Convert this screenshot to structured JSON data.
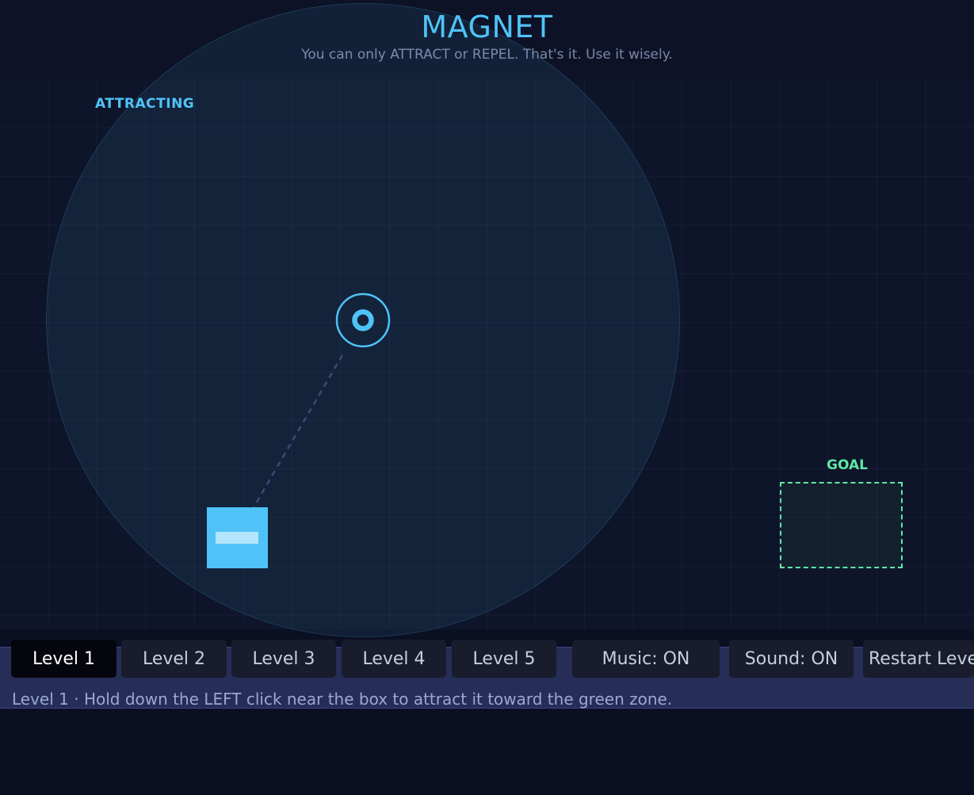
{
  "header": {
    "title": "MAGNET",
    "subtitle": "You can only ATTRACT or REPEL. That's it. Use it wisely."
  },
  "game": {
    "mode_label": "ATTRACTING",
    "goal_label": "GOAL",
    "box_polarity": "minus"
  },
  "controls": {
    "levels": [
      {
        "label": "Level 1",
        "active": true
      },
      {
        "label": "Level 2",
        "active": false
      },
      {
        "label": "Level 3",
        "active": false
      },
      {
        "label": "Level 4",
        "active": false
      },
      {
        "label": "Level 5",
        "active": false
      }
    ],
    "music_label": "Music: ON",
    "sound_label": "Sound: ON",
    "restart_label": "Restart Level"
  },
  "status": {
    "text": "Level 1 · Hold down the LEFT click near the box to attract it toward the green zone."
  },
  "colors": {
    "accent": "#4fc3f7",
    "goal": "#5ee7a8",
    "ground": "#262d57",
    "background": "#0b0f22"
  }
}
